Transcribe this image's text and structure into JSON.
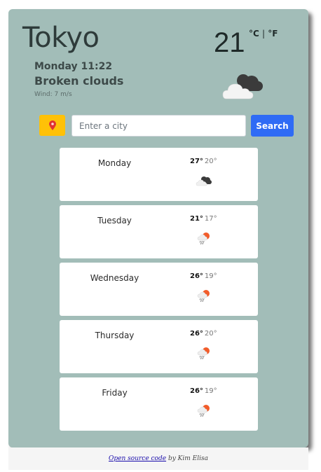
{
  "current": {
    "city": "Tokyo",
    "datetime": "Monday 11:22",
    "description": "Broken clouds",
    "wind_label": "Wind:",
    "wind_value": "7",
    "wind_unit": "m/s",
    "temperature": "21",
    "unit_celsius": "°C",
    "unit_separator": "|",
    "unit_fahrenheit": "°F",
    "icon": "broken-clouds-icon"
  },
  "search": {
    "placeholder": "Enter a city",
    "value": "",
    "button_label": "Search",
    "location_icon": "map-pin-icon"
  },
  "forecast": [
    {
      "day": "Monday",
      "max": "27°",
      "min": "20°",
      "icon": "broken-clouds-icon"
    },
    {
      "day": "Tuesday",
      "max": "21°",
      "min": "17°",
      "icon": "sun-rain-icon"
    },
    {
      "day": "Wednesday",
      "max": "26°",
      "min": "19°",
      "icon": "sun-rain-icon"
    },
    {
      "day": "Thursday",
      "max": "26°",
      "min": "20°",
      "icon": "sun-rain-icon"
    },
    {
      "day": "Friday",
      "max": "26°",
      "min": "19°",
      "icon": "sun-rain-icon"
    }
  ],
  "footer": {
    "link_text": "Open source code",
    "by_text": "by Kim Elisa"
  },
  "colors": {
    "card_background": "#a2bdb8",
    "location_button": "#ffc107",
    "search_button": "#2f6bf5"
  }
}
